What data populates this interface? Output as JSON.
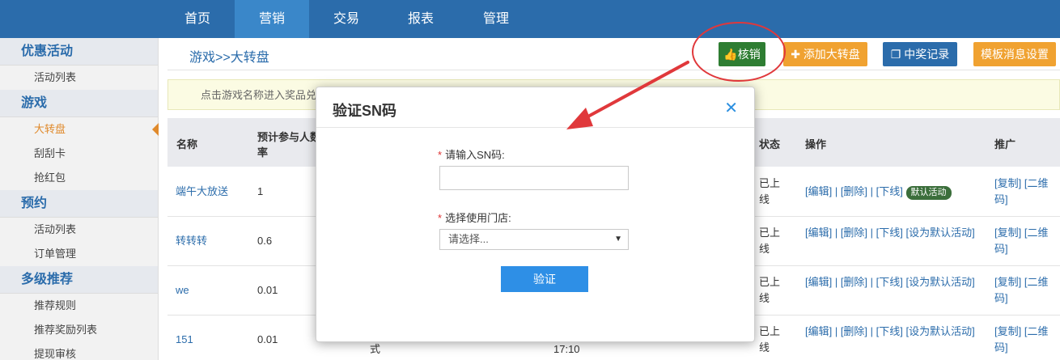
{
  "topnav": {
    "tabs": [
      {
        "label": "首页"
      },
      {
        "label": "营销"
      },
      {
        "label": "交易"
      },
      {
        "label": "报表"
      },
      {
        "label": "管理"
      }
    ]
  },
  "sidebar": {
    "groups": [
      {
        "title": "优惠活动",
        "items": [
          "活动列表"
        ]
      },
      {
        "title": "游戏",
        "items": [
          "大转盘",
          "刮刮卡",
          "抢红包"
        ]
      },
      {
        "title": "预约",
        "items": [
          "活动列表",
          "订单管理"
        ]
      },
      {
        "title": "多级推荐",
        "items": [
          "推荐规则",
          "推荐奖励列表",
          "提现审核"
        ]
      }
    ]
  },
  "breadcrumb": "游戏>>大转盘",
  "toolbar": {
    "verify_label": "核销",
    "add_label": "添加大转盘",
    "records_label": "中奖记录",
    "template_label": "模板消息设置"
  },
  "notice": "点击游戏名称进入奖品兑",
  "table": {
    "headers": {
      "name": "名称",
      "expected_line1": "预计参与人数",
      "expected_line2": "率",
      "status": "状态",
      "ops": "操作",
      "promo": "推广"
    },
    "rows": [
      {
        "name": "端午大放送",
        "rate": "1",
        "status": "已上线",
        "ops": "[编辑] | [删除] | [下线]",
        "badge": "默认活动",
        "promo": "[复制] [二维码]"
      },
      {
        "name": "转转转",
        "rate": "0.6",
        "status": "已上线",
        "ops": "[编辑] | [删除] | [下线] [设为默认活动]",
        "badge": "",
        "promo": "[复制] [二维码]"
      },
      {
        "name": "we",
        "rate": "0.01",
        "status": "已上线",
        "ops": "[编辑] | [删除] | [下线] [设为默认活动]",
        "badge": "",
        "promo": "[复制] [二维码]"
      },
      {
        "name": "151",
        "rate": "0.01",
        "status": "已上线",
        "ops": "[编辑] | [删除] | [下线] [设为默认活动]",
        "badge": "",
        "promo": "[复制] [二维码]"
      }
    ],
    "fragments": {
      "style": "式",
      "time": "17:10"
    }
  },
  "modal": {
    "title": "验证SN码",
    "sn_label": "请输入SN码:",
    "sn_value": "",
    "store_label": "选择使用门店:",
    "store_selected": "请选择...",
    "submit_label": "验证",
    "required_mark": "*"
  },
  "colors": {
    "nav_bg": "#2b6cab",
    "nav_active": "#3a87c9",
    "accent_orange": "#f0a231",
    "green": "#2e7d32",
    "annotation_red": "#e0383b"
  },
  "icons": {
    "close": "close-icon",
    "thumb": "thumb-icon",
    "plus": "plus-icon",
    "copy": "copy-icon",
    "caret": "caret-down-icon"
  }
}
